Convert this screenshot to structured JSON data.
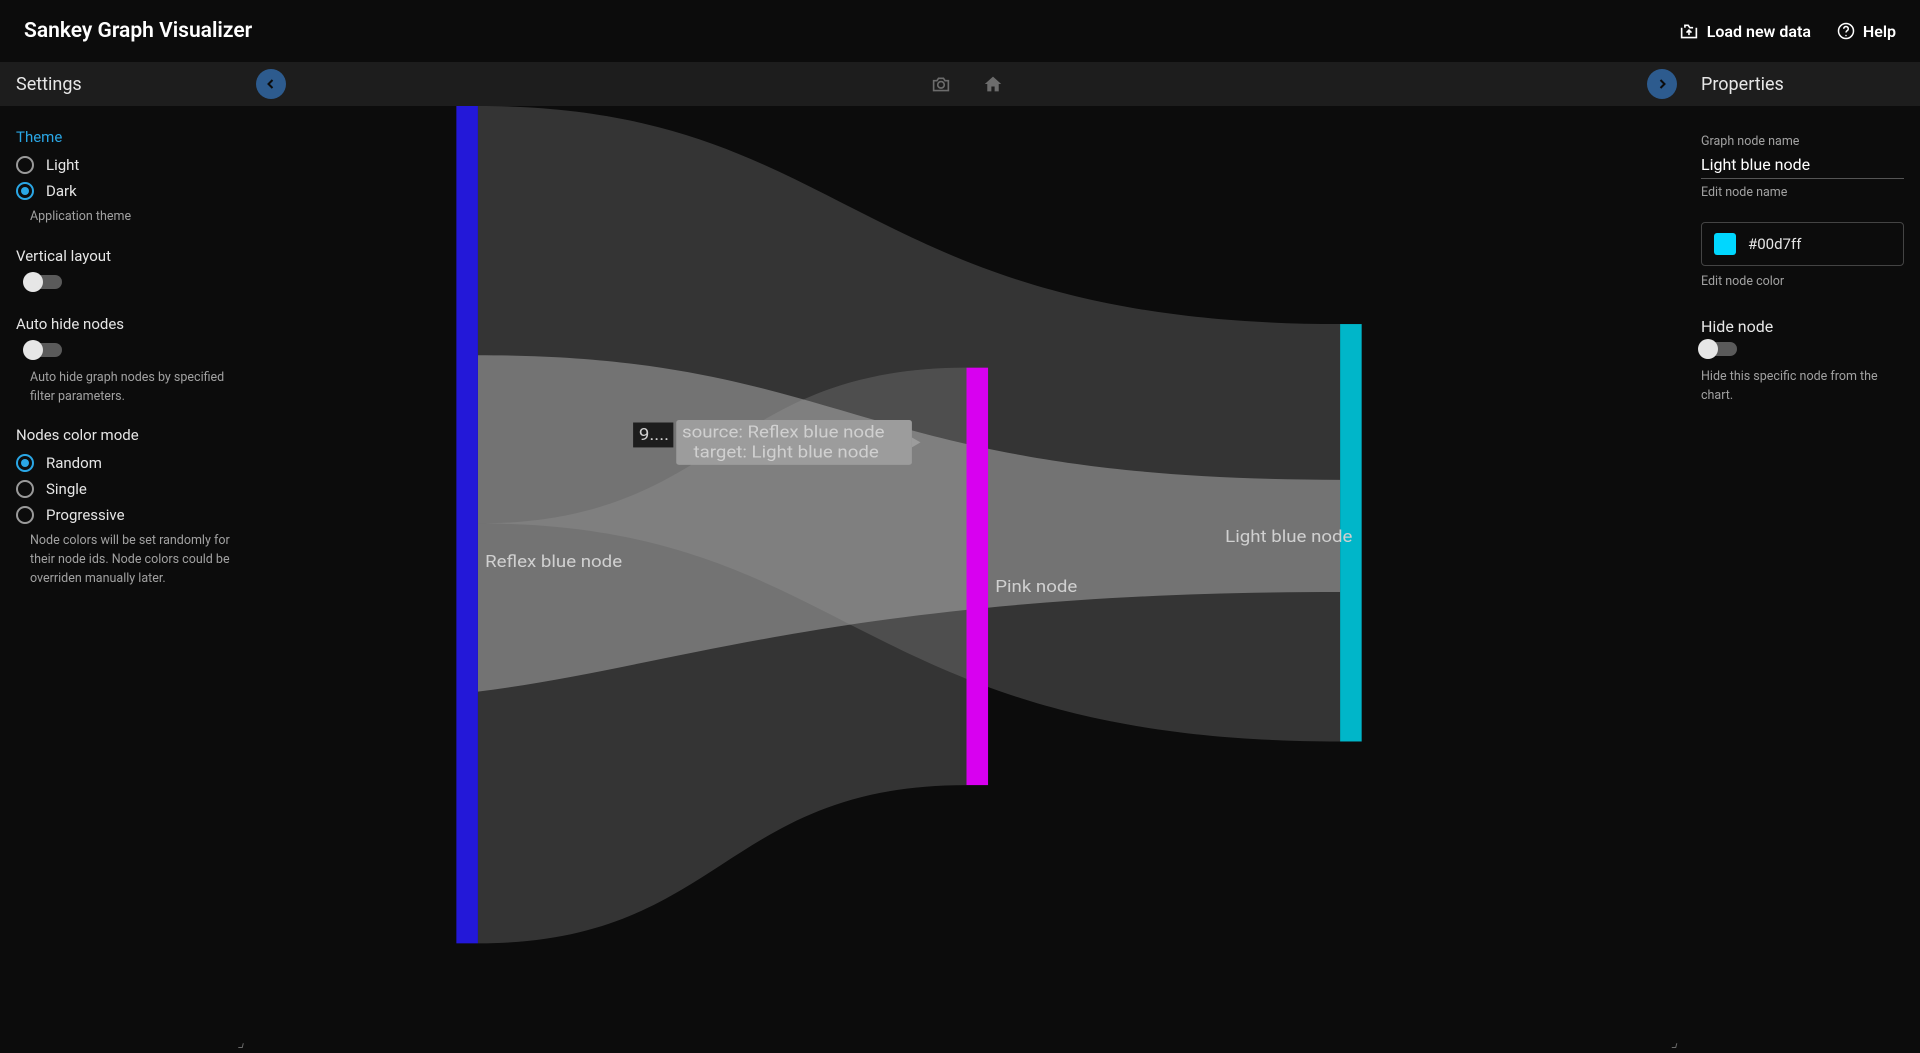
{
  "app_title": "Sankey Graph Visualizer",
  "top": {
    "load_label": "Load new data",
    "help_label": "Help"
  },
  "settings": {
    "header": "Settings",
    "theme": {
      "label": "Theme",
      "light": "Light",
      "dark": "Dark",
      "help": "Application theme"
    },
    "vertical_layout": {
      "label": "Vertical layout"
    },
    "auto_hide": {
      "label": "Auto hide nodes",
      "help": "Auto hide graph nodes by specified filter parameters."
    },
    "color_mode": {
      "label": "Nodes color mode",
      "random": "Random",
      "single": "Single",
      "progressive": "Progressive",
      "help": "Node colors will be set randomly for their node ids. Node colors could be overriden manually later."
    }
  },
  "props": {
    "header": "Properties",
    "node_name_label": "Graph node name",
    "node_name_value": "Light blue node",
    "edit_name_hint": "Edit node name",
    "color_hex": "#00d7ff",
    "edit_color_hint": "Edit node color",
    "hide_node_label": "Hide node",
    "hide_node_help": "Hide this specific node from the chart."
  },
  "chart_data": {
    "type": "sankey",
    "nodes": [
      {
        "id": "reflex_blue",
        "label": "Reflex blue node",
        "color": "#2318d8"
      },
      {
        "id": "pink",
        "label": "Pink node",
        "color": "#d800f0"
      },
      {
        "id": "light_blue",
        "label": "Light blue node",
        "color": "#00b6c9"
      }
    ],
    "links": [
      {
        "source": "reflex_blue",
        "target": "pink",
        "value": 50
      },
      {
        "source": "reflex_blue",
        "target": "light_blue",
        "value": 25
      },
      {
        "source": "pink",
        "target": "light_blue",
        "value": 25
      }
    ],
    "tooltip": {
      "value_text": "9....",
      "line1": "source: Reflex blue node",
      "line2": "target: Light blue node"
    }
  }
}
